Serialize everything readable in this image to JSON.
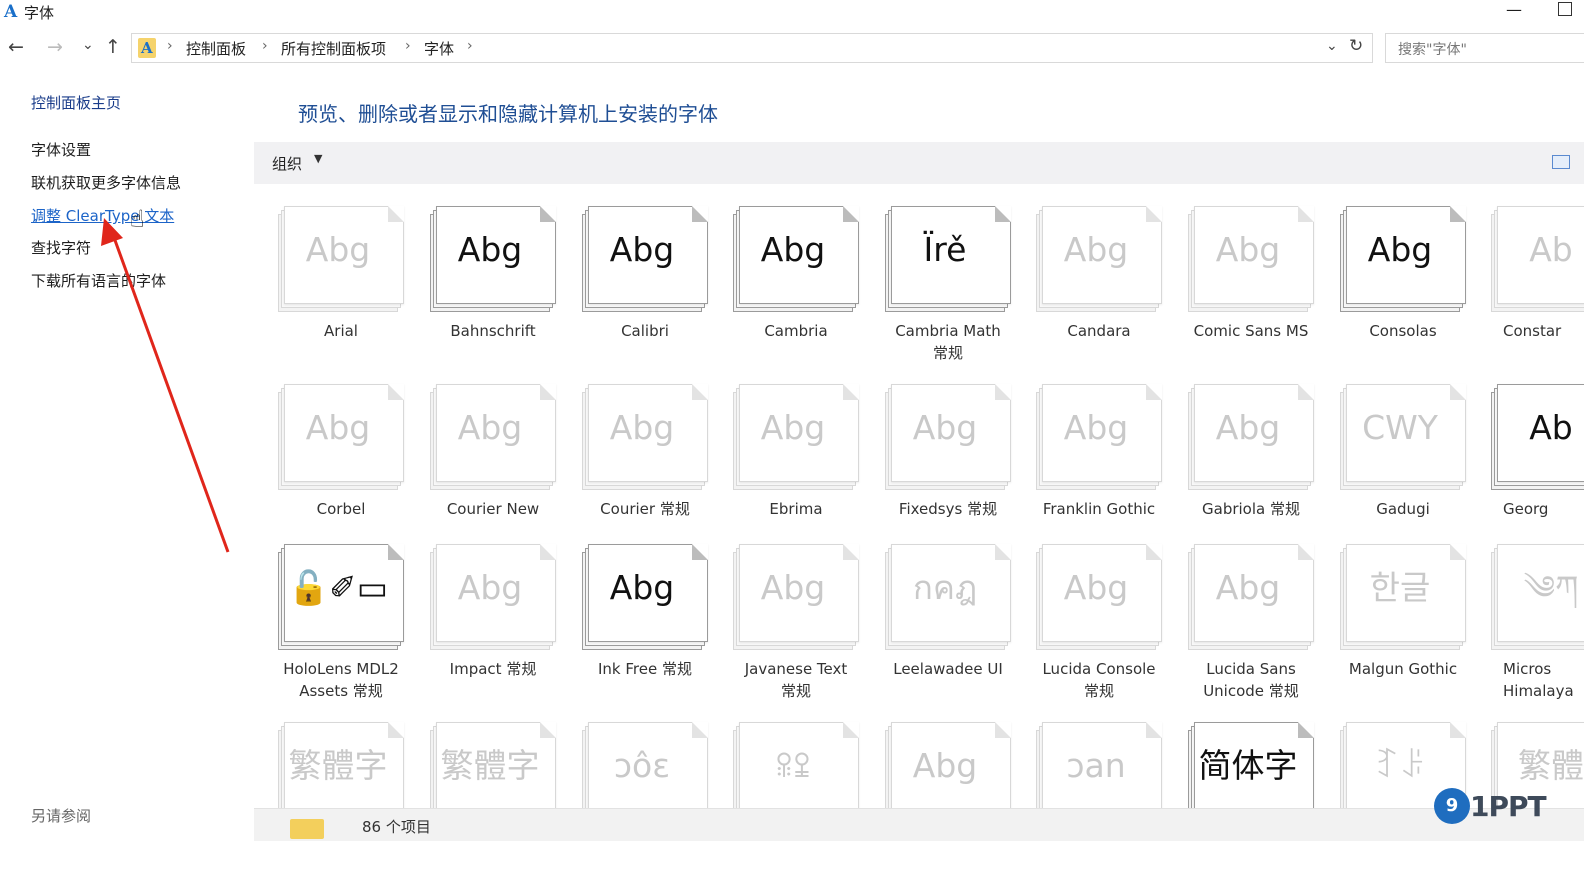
{
  "window": {
    "title": "字体",
    "app_icon": "A"
  },
  "address": {
    "back_icon": "←",
    "forward_icon": "→",
    "recent_icon": "⌄",
    "up_icon": "↑",
    "crumbs": [
      "控制面板",
      "所有控制面板项",
      "字体"
    ],
    "dropdown_icon": "⌄",
    "refresh_icon": "↻",
    "search_placeholder": "搜索\"字体\""
  },
  "sidebar": {
    "home": "控制面板主页",
    "links": [
      "字体设置",
      "联机获取更多字体信息",
      "调整 ClearType 文本",
      "查找字符",
      "下载所有语言的字体"
    ],
    "see_also": "另请参阅"
  },
  "main": {
    "title": "预览、删除或者显示和隐藏计算机上安装的字体",
    "organize_label": "组织",
    "organize_arrow": "▼"
  },
  "fonts": [
    {
      "name": "Arial",
      "sample": "Abg",
      "shown": false
    },
    {
      "name": "Bahnschrift",
      "sample": "Abg",
      "shown": true
    },
    {
      "name": "Calibri",
      "sample": "Abg",
      "shown": true
    },
    {
      "name": "Cambria",
      "sample": "Abg",
      "shown": true
    },
    {
      "name": "Cambria Math\n常规",
      "sample": "Ïrě",
      "shown": true
    },
    {
      "name": "Candara",
      "sample": "Abg",
      "shown": false
    },
    {
      "name": "Comic Sans MS",
      "sample": "Abg",
      "shown": false
    },
    {
      "name": "Consolas",
      "sample": "Abg",
      "shown": true
    },
    {
      "name": "Constar",
      "sample": "Ab",
      "shown": false
    },
    {
      "name": "Corbel",
      "sample": "Abg",
      "shown": false
    },
    {
      "name": "Courier New",
      "sample": "Abg",
      "shown": false
    },
    {
      "name": "Courier 常规",
      "sample": "Abg",
      "shown": false
    },
    {
      "name": "Ebrima",
      "sample": "Abg",
      "shown": false
    },
    {
      "name": "Fixedsys 常规",
      "sample": "Abg",
      "shown": false
    },
    {
      "name": "Franklin Gothic",
      "sample": "Abg",
      "shown": false
    },
    {
      "name": "Gabriola 常规",
      "sample": "Abg",
      "shown": false
    },
    {
      "name": "Gadugi",
      "sample": "CWY",
      "shown": false
    },
    {
      "name": "Georg",
      "sample": "Ab",
      "shown": true
    },
    {
      "name": "HoloLens MDL2\nAssets 常规",
      "sample": "🔓✐▭",
      "shown": true
    },
    {
      "name": "Impact 常规",
      "sample": "Abg",
      "shown": false
    },
    {
      "name": "Ink Free 常规",
      "sample": "Abg",
      "shown": true
    },
    {
      "name": "Javanese Text\n常规",
      "sample": "Abg",
      "shown": false
    },
    {
      "name": "Leelawadee UI",
      "sample": "กคฎ",
      "shown": false
    },
    {
      "name": "Lucida Console\n常规",
      "sample": "Abg",
      "shown": false
    },
    {
      "name": "Lucida Sans\nUnicode 常规",
      "sample": "Abg",
      "shown": false
    },
    {
      "name": "Malgun Gothic",
      "sample": "한글",
      "shown": false
    },
    {
      "name": "Micros\nHimalaya",
      "sample": "༄ཀ",
      "shown": false
    },
    {
      "name": "",
      "sample": "繁體字",
      "shown": false
    },
    {
      "name": "",
      "sample": "繁體字",
      "shown": false
    },
    {
      "name": "",
      "sample": "ɔôɛ",
      "shown": false
    },
    {
      "name": "",
      "sample": "ꕉꔍ",
      "shown": false
    },
    {
      "name": "",
      "sample": "Abg",
      "shown": false
    },
    {
      "name": "",
      "sample": "ɔan",
      "shown": false
    },
    {
      "name": "",
      "sample": "简体字",
      "shown": true
    },
    {
      "name": "",
      "sample": "ꆈꌠ",
      "shown": false
    },
    {
      "name": "",
      "sample": "繁體",
      "shown": false
    }
  ],
  "status": {
    "count": "86 个项目"
  },
  "watermark": {
    "badge": "9",
    "text": "1PPT"
  },
  "colors": {
    "link": "#1c64c8",
    "title": "#1f4e94",
    "arrow": "#e0261b"
  }
}
